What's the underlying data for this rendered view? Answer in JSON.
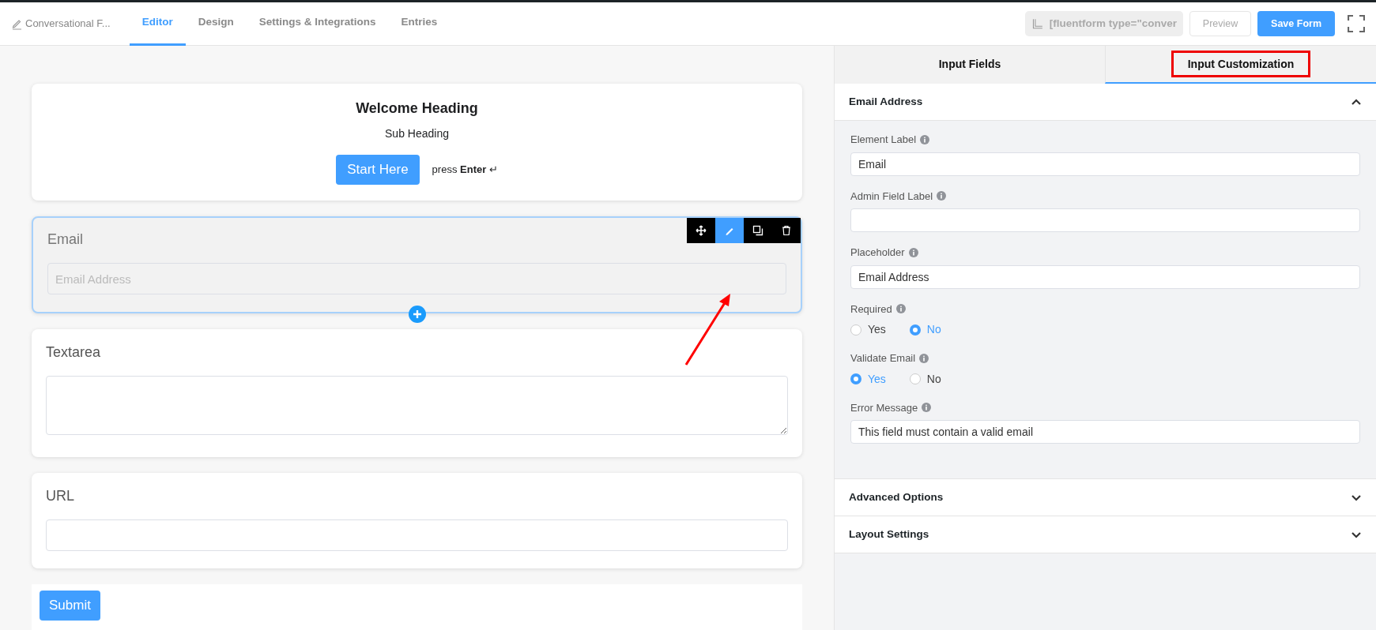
{
  "topbar": {
    "form_title": "Conversational F...",
    "tabs": [
      {
        "label": "Editor",
        "selected": true
      },
      {
        "label": "Design",
        "selected": false
      },
      {
        "label": "Settings & Integrations",
        "selected": false
      },
      {
        "label": "Entries",
        "selected": false
      }
    ],
    "shortcode": "[fluentform type=\"conver",
    "preview_button": "Preview",
    "save_button": "Save Form"
  },
  "canvas": {
    "welcome": {
      "heading": "Welcome Heading",
      "subheading": "Sub Heading",
      "button": "Start Here",
      "hint": "press **Enter** ↵"
    },
    "fields": [
      {
        "kind": "email",
        "label": "Email",
        "placeholder": "Email Address",
        "selected": true
      },
      {
        "kind": "textarea",
        "label": "Textarea",
        "selected": false
      },
      {
        "kind": "url",
        "label": "URL",
        "selected": false
      }
    ],
    "submit_button": "Submit"
  },
  "panel": {
    "tabs": [
      {
        "label": "Input Fields",
        "selected": false,
        "highlighted": false
      },
      {
        "label": "Input Customization",
        "selected": true,
        "highlighted": true
      }
    ],
    "sections": [
      {
        "title": "Email Address",
        "expanded": true,
        "settings": [
          {
            "kind": "text",
            "label": "Element Label",
            "value": "Email"
          },
          {
            "kind": "text",
            "label": "Admin Field Label"
          },
          {
            "kind": "text",
            "label": "Placeholder",
            "value": "Email Address"
          },
          {
            "kind": "radio",
            "label": "Required",
            "options": [
              {
                "label": "Yes",
                "selected": false
              },
              {
                "label": "No",
                "selected": true
              }
            ]
          },
          {
            "kind": "radio",
            "label": "Validate Email",
            "options": [
              {
                "label": "Yes",
                "selected": true
              },
              {
                "label": "No",
                "selected": false
              }
            ]
          },
          {
            "kind": "text",
            "label": "Error Message",
            "value": "This field must contain a valid email"
          }
        ]
      },
      {
        "title": "Advanced Options",
        "expanded": false
      },
      {
        "title": "Layout Settings",
        "expanded": false
      }
    ]
  }
}
